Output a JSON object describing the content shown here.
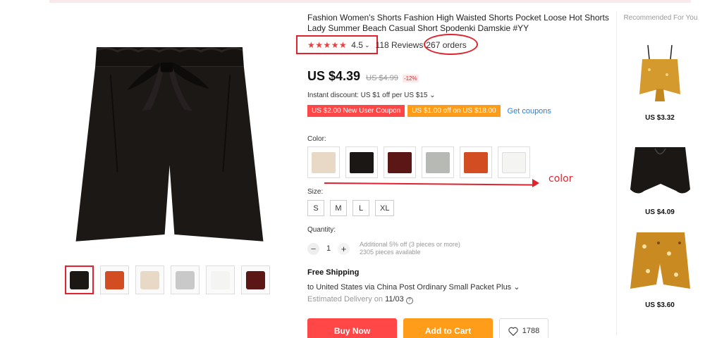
{
  "product": {
    "title": "Fashion Women's Shorts Fashion High Waisted Shorts Pocket Loose Hot Shorts Lady Summer Beach Casual Short Spodenki Damskie #YY",
    "rating_stars": "★★★★★",
    "rating_value": "4.5",
    "rating_caret": "⌄",
    "reviews": "118 Reviews",
    "orders": "267 orders",
    "price": "US $4.39",
    "old_price": "US $4.99",
    "discount": "-12%",
    "instant_discount": "Instant discount: US $1 off per US $15 ⌄",
    "coupons": [
      {
        "label": "US $2.00 New User Coupon",
        "color": "#ff4747"
      },
      {
        "label": "US $1.00 off on US $18.00",
        "color": "#ff9c1a"
      }
    ],
    "get_coupons": "Get coupons",
    "color_label": "Color:",
    "colors": [
      {
        "name": "beige",
        "hex": "#e8d8c6"
      },
      {
        "name": "black",
        "hex": "#1a1715"
      },
      {
        "name": "wine-red",
        "hex": "#5b1616"
      },
      {
        "name": "gray",
        "hex": "#b7b9b5"
      },
      {
        "name": "orange",
        "hex": "#d24e22"
      },
      {
        "name": "white",
        "hex": "#f4f4f2"
      }
    ],
    "annotation_color_note": "color",
    "size_label": "Size:",
    "sizes": [
      "S",
      "M",
      "L",
      "XL"
    ],
    "quantity_label": "Quantity:",
    "quantity_value": "1",
    "quantity_minus": "−",
    "quantity_plus": "+",
    "quantity_note_1": "Additional 5% off (3 pieces or more)",
    "quantity_note_2": "2305 pieces available",
    "shipping_title": "Free Shipping",
    "shipping_via": "to United States via China Post Ordinary Small Packet Plus ⌄",
    "delivery_prefix": "Estimated Delivery on",
    "delivery_date": "11/03",
    "buy_now": "Buy Now",
    "add_to_cart": "Add to Cart",
    "wishlist_count": "1788"
  },
  "gallery": {
    "main_color": "#1b1816",
    "thumbs": [
      {
        "hex": "#1a1715",
        "active": true
      },
      {
        "hex": "#d24e22",
        "active": false
      },
      {
        "hex": "#e8d8c6",
        "active": false
      },
      {
        "hex": "#c9c9c9",
        "active": false
      },
      {
        "hex": "#f4f4f2",
        "active": false
      },
      {
        "hex": "#5b1616",
        "active": false
      }
    ]
  },
  "recommended": {
    "title": "Recommended For You",
    "items": [
      {
        "price": "US $3.32",
        "hex": "#d59a2e"
      },
      {
        "price": "US $4.09",
        "hex": "#1a1715"
      },
      {
        "price": "US $3.60",
        "hex": "#c98a22"
      }
    ]
  }
}
